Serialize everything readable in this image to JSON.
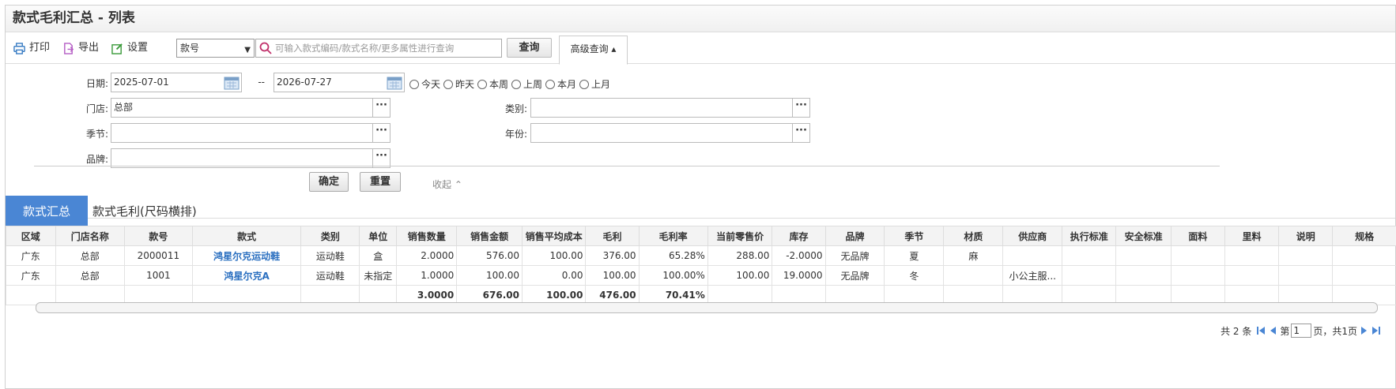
{
  "title": "款式毛利汇总 - 列表",
  "toolbar": {
    "print": "打印",
    "export": "导出",
    "settings": "设置",
    "search_field": "款号",
    "search_placeholder": "可输入款式编码/款式名称/更多属性进行查询",
    "query": "查询",
    "advanced": "高级查询 ▴"
  },
  "filters": {
    "date_label": "日期:",
    "date_from": "2025-07-01",
    "date_sep": "--",
    "date_to": "2026-07-27",
    "quick_ranges": [
      "今天",
      "昨天",
      "本周",
      "上周",
      "本月",
      "上月"
    ],
    "store_label": "门店:",
    "store_value": "总部",
    "category_label": "类别:",
    "category_value": "",
    "season_label": "季节:",
    "season_value": "",
    "year_label": "年份:",
    "year_value": "",
    "brand_label": "品牌:",
    "brand_value": "",
    "confirm": "确定",
    "reset": "重置",
    "collapse": "收起 ⌃"
  },
  "tabs": [
    "款式汇总",
    "款式毛利(尺码横排)"
  ],
  "table": {
    "headers": [
      "区域",
      "门店名称",
      "款号",
      "款式",
      "类别",
      "单位",
      "销售数量",
      "销售金额",
      "销售平均成本",
      "毛利",
      "毛利率",
      "当前零售价",
      "库存",
      "品牌",
      "季节",
      "材质",
      "供应商",
      "执行标准",
      "安全标准",
      "面料",
      "里料",
      "说明",
      "规格"
    ],
    "rows": [
      [
        "广东",
        "总部",
        "2000011",
        "鸿星尔克运动鞋",
        "运动鞋",
        "盒",
        "2.0000",
        "576.00",
        "100.00",
        "376.00",
        "65.28%",
        "288.00",
        "-2.0000",
        "无品牌",
        "夏",
        "麻",
        "",
        "",
        "",
        "",
        "",
        "",
        ""
      ],
      [
        "广东",
        "总部",
        "1001",
        "鸿星尔克A",
        "运动鞋",
        "未指定",
        "1.0000",
        "100.00",
        "0.00",
        "100.00",
        "100.00%",
        "100.00",
        "19.0000",
        "无品牌",
        "冬",
        "",
        "小公主服...",
        "",
        "",
        "",
        "",
        "",
        ""
      ]
    ],
    "total": [
      "",
      "",
      "",
      "",
      "",
      "",
      "3.0000",
      "676.00",
      "100.00",
      "476.00",
      "70.41%",
      "",
      "",
      "",
      "",
      "",
      "",
      "",
      "",
      "",
      "",
      "",
      ""
    ]
  },
  "pager": {
    "total_text": "共 2 条",
    "page_prefix": "第",
    "page_value": "1",
    "page_suffix": "页，共1页"
  }
}
